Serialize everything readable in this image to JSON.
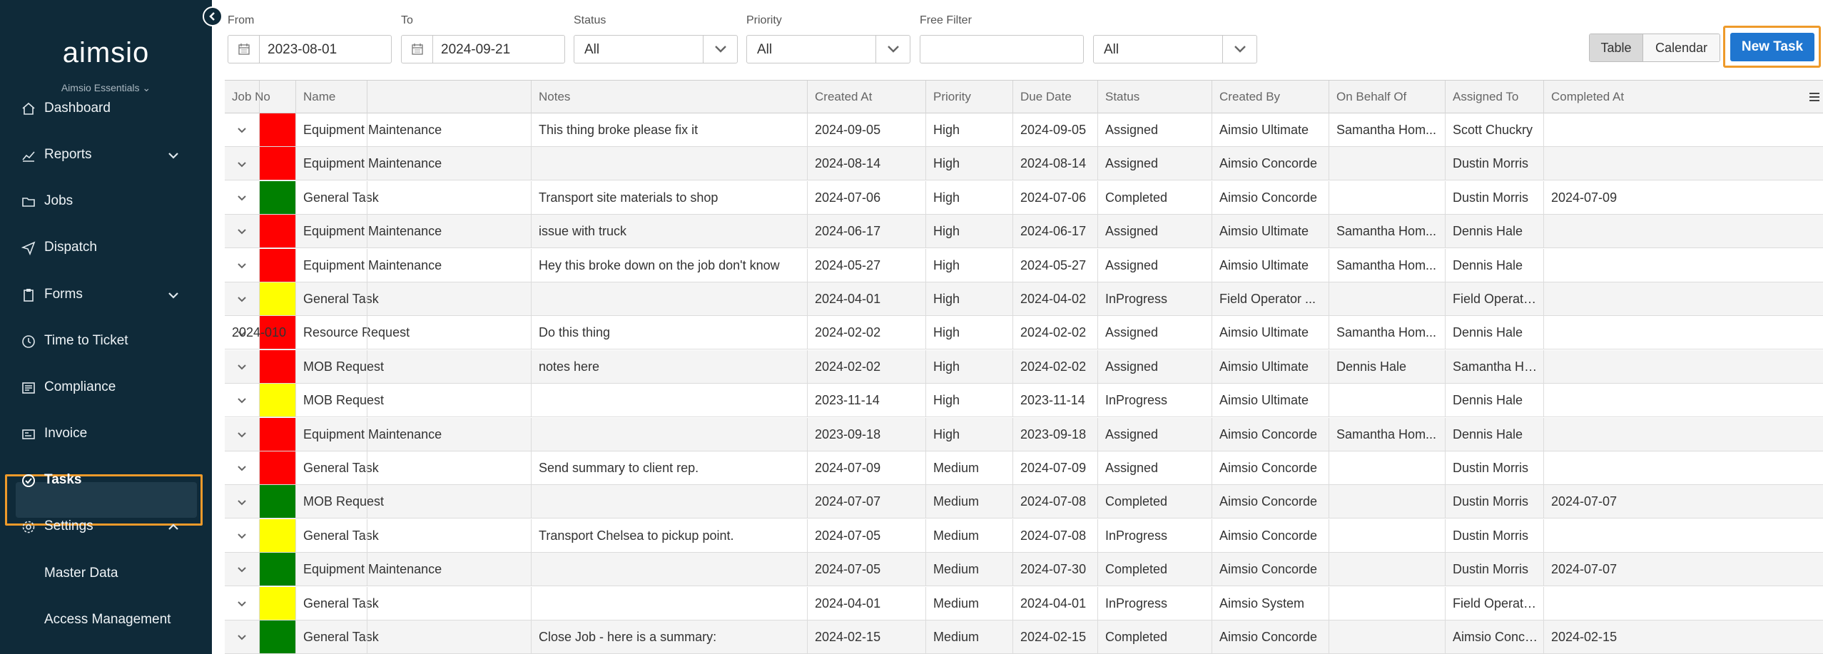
{
  "sidebar": {
    "logo": "aimsio",
    "plan": "Aimsio Essentials ⌄",
    "items": [
      {
        "label": "Dashboard",
        "icon": "home-icon",
        "expand": ""
      },
      {
        "label": "Reports",
        "icon": "chart-icon",
        "expand": "down"
      },
      {
        "label": "Jobs",
        "icon": "folder-icon",
        "expand": ""
      },
      {
        "label": "Dispatch",
        "icon": "send-icon",
        "expand": ""
      },
      {
        "label": "Forms",
        "icon": "clipboard-icon",
        "expand": "down"
      },
      {
        "label": "Time to Ticket",
        "icon": "clock-icon",
        "expand": ""
      },
      {
        "label": "Compliance",
        "icon": "document-icon",
        "expand": ""
      },
      {
        "label": "Invoice",
        "icon": "invoice-icon",
        "expand": ""
      },
      {
        "label": "Tasks",
        "icon": "check-circle-icon",
        "expand": ""
      },
      {
        "label": "Settings",
        "icon": "gear-icon",
        "expand": "up"
      },
      {
        "label": "Master Data",
        "icon": "",
        "expand": ""
      },
      {
        "label": "Access Management",
        "icon": "",
        "expand": ""
      }
    ]
  },
  "filters": {
    "from_label": "From",
    "from_value": "2023-08-01",
    "to_label": "To",
    "to_value": "2024-09-21",
    "status_label": "Status",
    "status_value": "All",
    "priority_label": "Priority",
    "priority_value": "All",
    "free_filter_label": "Free Filter",
    "free_filter_value": "",
    "extra_value": "All"
  },
  "view_toggle": {
    "table": "Table",
    "calendar": "Calendar"
  },
  "new_task": "New Task",
  "colors": {
    "red": "#ff0000",
    "green": "#008000",
    "yellow": "#ffff00",
    "accent": "#1f76d0",
    "highlight": "#ee9a2a",
    "sidebar": "#0f2a39"
  },
  "table": {
    "columns": [
      "Name",
      "Notes",
      "Created At",
      "Priority",
      "Due Date",
      "Status",
      "Created By",
      "On Behalf Of",
      "Assigned To",
      "Completed At",
      "Job No"
    ],
    "rows": [
      {
        "color": "red",
        "cells": [
          "Equipment Maintenance",
          "This thing broke please fix it",
          "2024-09-05",
          "High",
          "2024-09-05",
          "Assigned",
          "Aimsio Ultimate",
          "Samantha Hom...",
          "Scott Chuckry",
          "",
          ""
        ]
      },
      {
        "color": "red",
        "cells": [
          "Equipment Maintenance",
          "",
          "2024-08-14",
          "High",
          "2024-08-14",
          "Assigned",
          "Aimsio Concorde",
          "",
          "Dustin Morris",
          "",
          ""
        ]
      },
      {
        "color": "green",
        "cells": [
          "General Task",
          "Transport site materials to shop",
          "2024-07-06",
          "High",
          "2024-07-06",
          "Completed",
          "Aimsio Concorde",
          "",
          "Dustin Morris",
          "2024-07-09",
          ""
        ]
      },
      {
        "color": "red",
        "cells": [
          "Equipment Maintenance",
          "issue with truck",
          "2024-06-17",
          "High",
          "2024-06-17",
          "Assigned",
          "Aimsio Ultimate",
          "Samantha Hom...",
          "Dennis Hale",
          "",
          ""
        ]
      },
      {
        "color": "red",
        "cells": [
          "Equipment Maintenance",
          "Hey this broke down on the job don't know",
          "2024-05-27",
          "High",
          "2024-05-27",
          "Assigned",
          "Aimsio Ultimate",
          "Samantha Hom...",
          "Dennis Hale",
          "",
          ""
        ]
      },
      {
        "color": "yellow",
        "cells": [
          "General Task",
          "",
          "2024-04-01",
          "High",
          "2024-04-02",
          "InProgress",
          "Field Operator ...",
          "",
          "Field Operator ...",
          "",
          ""
        ]
      },
      {
        "color": "red",
        "cells": [
          "Resource Request",
          "Do this thing",
          "2024-02-02",
          "High",
          "2024-02-02",
          "Assigned",
          "Aimsio Ultimate",
          "Samantha Hom...",
          "Dennis Hale",
          "",
          "2024-010"
        ]
      },
      {
        "color": "red",
        "cells": [
          "MOB Request",
          "notes here",
          "2024-02-02",
          "High",
          "2024-02-02",
          "Assigned",
          "Aimsio Ultimate",
          "Dennis Hale",
          "Samantha Hom...",
          "",
          ""
        ]
      },
      {
        "color": "yellow",
        "cells": [
          "MOB Request",
          "",
          "2023-11-14",
          "High",
          "2023-11-14",
          "InProgress",
          "Aimsio Ultimate",
          "",
          "Dennis Hale",
          "",
          ""
        ]
      },
      {
        "color": "red",
        "cells": [
          "Equipment Maintenance",
          "",
          "2023-09-18",
          "High",
          "2023-09-18",
          "Assigned",
          "Aimsio Concorde",
          "Samantha Hom...",
          "Dennis Hale",
          "",
          ""
        ]
      },
      {
        "color": "red",
        "cells": [
          "General Task",
          "Send summary to client rep.",
          "2024-07-09",
          "Medium",
          "2024-07-09",
          "Assigned",
          "Aimsio Concorde",
          "",
          "Dustin Morris",
          "",
          ""
        ]
      },
      {
        "color": "green",
        "cells": [
          "MOB Request",
          "",
          "2024-07-07",
          "Medium",
          "2024-07-08",
          "Completed",
          "Aimsio Concorde",
          "",
          "Dustin Morris",
          "2024-07-07",
          ""
        ]
      },
      {
        "color": "yellow",
        "cells": [
          "General Task",
          "Transport Chelsea to pickup point.",
          "2024-07-05",
          "Medium",
          "2024-07-08",
          "InProgress",
          "Aimsio Concorde",
          "",
          "Dustin Morris",
          "",
          ""
        ]
      },
      {
        "color": "green",
        "cells": [
          "Equipment Maintenance",
          "",
          "2024-07-05",
          "Medium",
          "2024-07-30",
          "Completed",
          "Aimsio Concorde",
          "",
          "Dustin Morris",
          "2024-07-07",
          ""
        ]
      },
      {
        "color": "yellow",
        "cells": [
          "General Task",
          "",
          "2024-04-01",
          "Medium",
          "2024-04-01",
          "InProgress",
          "Aimsio System",
          "",
          "Field Operator ...",
          "",
          ""
        ]
      },
      {
        "color": "green",
        "cells": [
          "General Task",
          "Close Job - here is a summary:",
          "2024-02-15",
          "Medium",
          "2024-02-15",
          "Completed",
          "Aimsio Concorde",
          "",
          "Aimsio Concorde",
          "2024-02-15",
          ""
        ]
      }
    ]
  }
}
